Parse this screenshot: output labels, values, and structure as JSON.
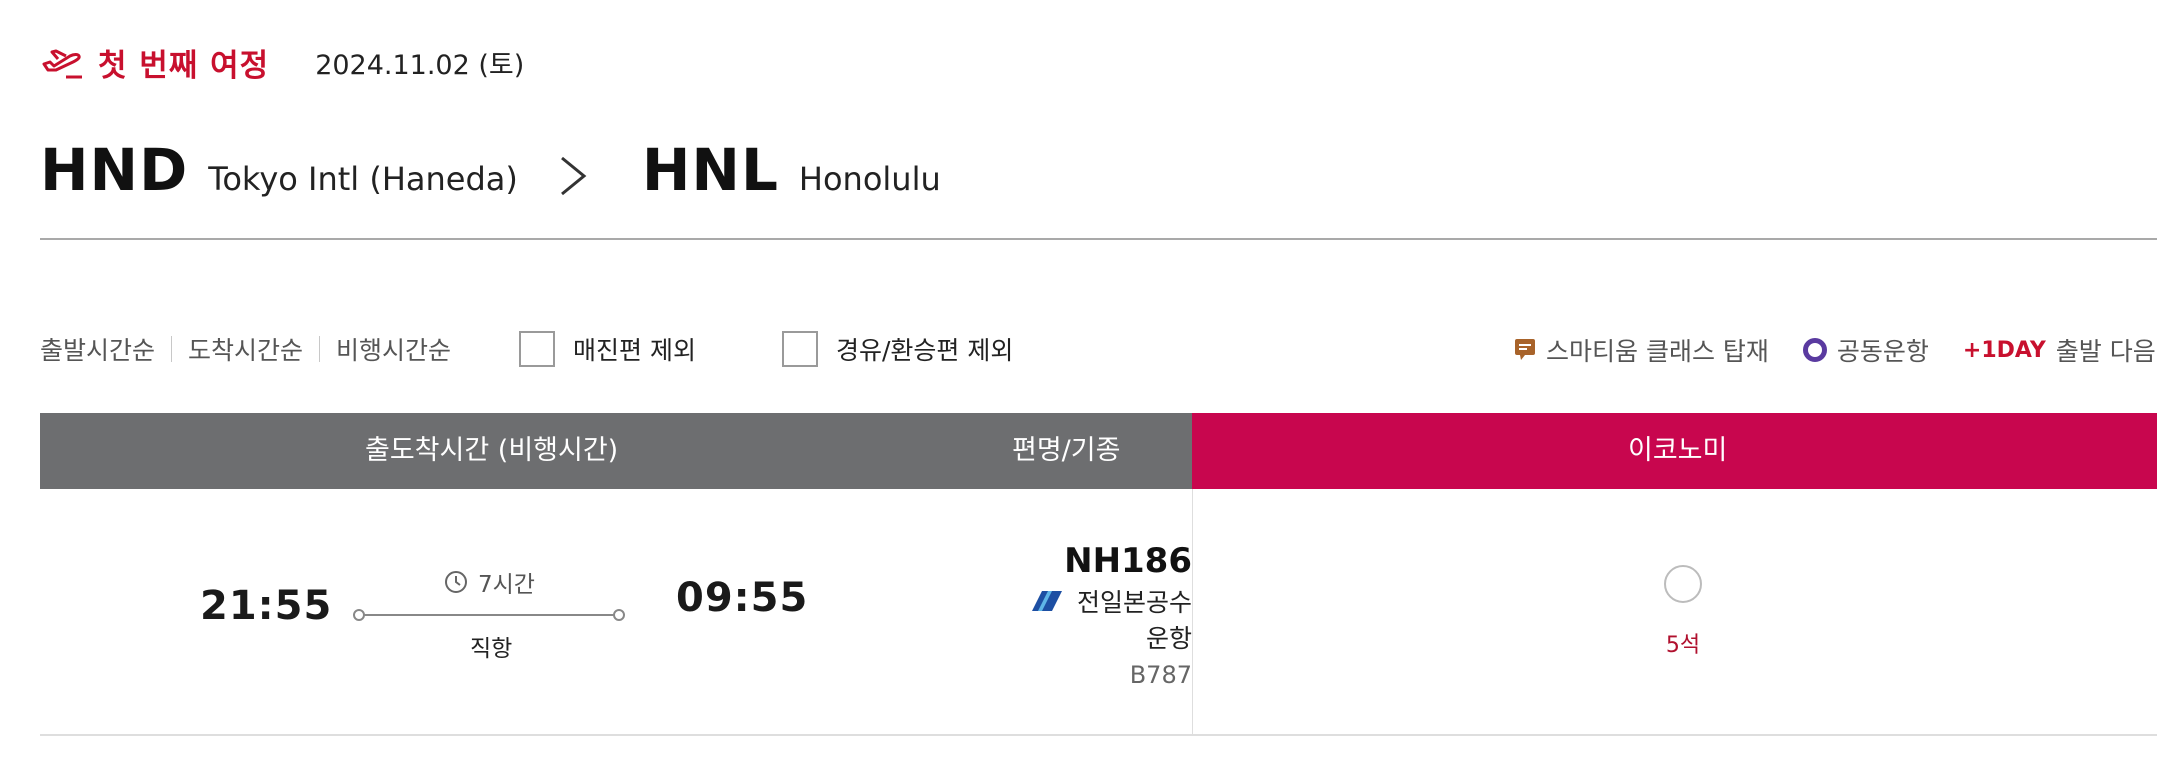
{
  "journey": {
    "title": "첫 번째 여정",
    "date": "2024.11.02 (토)",
    "icon": "plane-takeoff-icon"
  },
  "route": {
    "origin_code": "HND",
    "origin_city": "Tokyo Intl (Haneda)",
    "destination_code": "HNL",
    "destination_city": "Honolulu",
    "arrow_icon": "chevron-right-icon"
  },
  "sort": {
    "items": [
      "출발시간순",
      "도착시간순",
      "비행시간순"
    ]
  },
  "filters": {
    "exclude_soldout": "매진편 제외",
    "exclude_transfer": "경유/환승편 제외"
  },
  "legend": {
    "smartium": "스마티움 클래스 탑재",
    "codeshare": "공동운항",
    "plus_day_badge": "+1DAY",
    "plus_day_text": "출발 다음날"
  },
  "table_header": {
    "time_col": "출도착시간 (비행시간)",
    "flight_col": "편명/기종",
    "economy_col": "이코노미"
  },
  "flights": [
    {
      "departure": "21:55",
      "arrival": "09:55",
      "duration": "7시간",
      "stops": "직항",
      "flight_no": "NH186",
      "operated_by_line1": "전일본공수",
      "operated_by_line2": "운항",
      "aircraft": "B787",
      "economy_seats": "5석"
    }
  ],
  "colors": {
    "brand_red": "#c8102e",
    "header_gray": "#6d6e70",
    "header_magenta": "#c8064e",
    "codeshare_purple": "#5a3aa0",
    "smartium_brown": "#a8632a"
  }
}
